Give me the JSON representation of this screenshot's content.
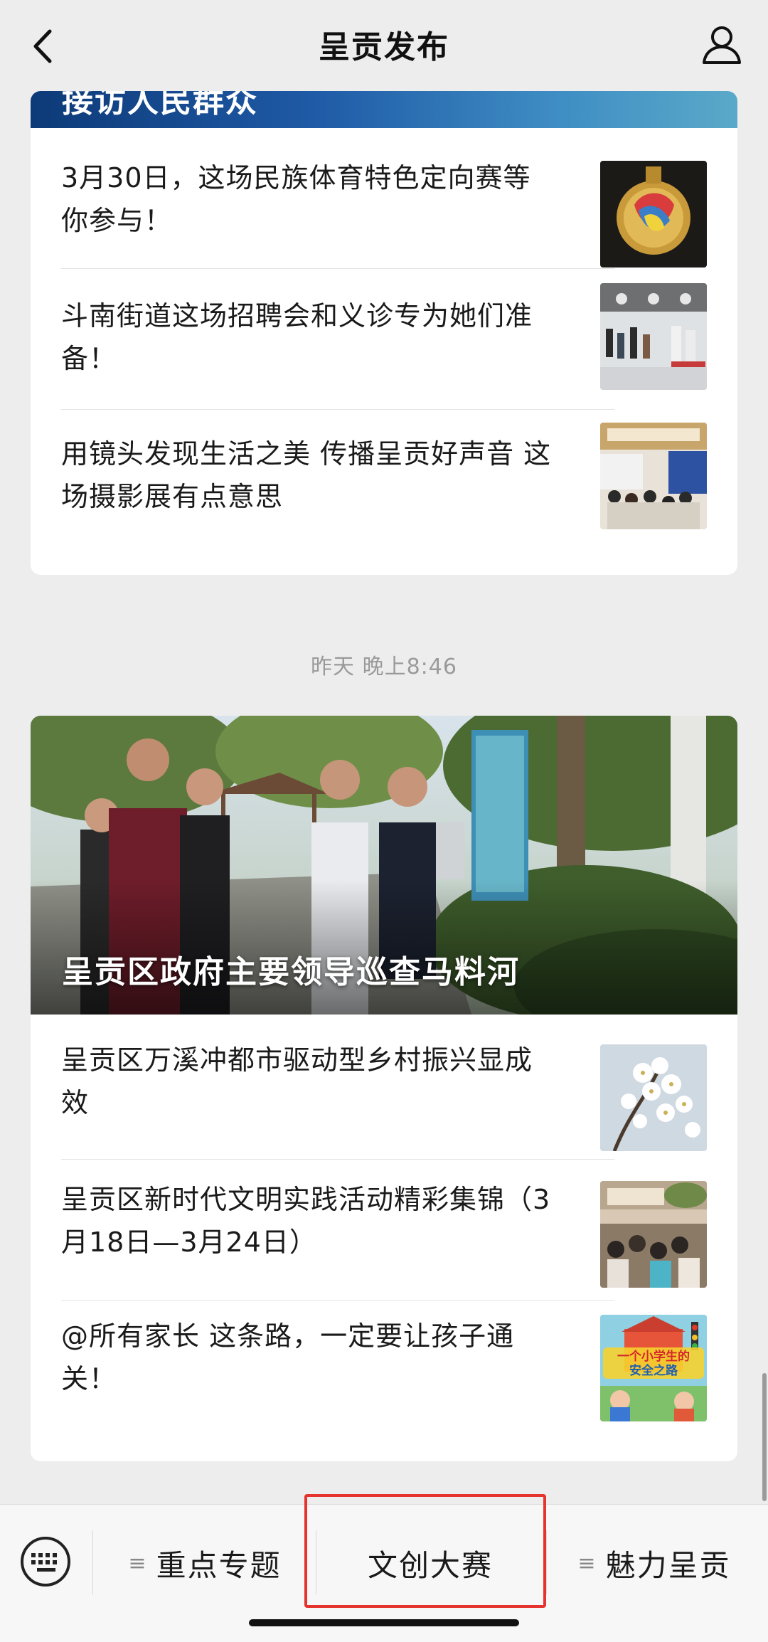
{
  "header": {
    "title": "呈贡发布"
  },
  "card1": {
    "banner_text": "接访人民群众",
    "items": [
      {
        "title_line1": "3月30日，这场民族体育特色定向赛等",
        "title_line2": "你参与！"
      },
      {
        "title_line1": "斗南街道这场招聘会和义诊专为她们准",
        "title_line2": "备！"
      },
      {
        "title_line1": "用镜头发现生活之美 传播呈贡好声音 这",
        "title_line2": "场摄影展有点意思"
      }
    ]
  },
  "timestamp": "昨天 晚上8:46",
  "card2": {
    "hero_title": "呈贡区政府主要领导巡查马料河",
    "items": [
      {
        "title_line1": "呈贡区万溪冲都市驱动型乡村振兴显成",
        "title_line2": "效"
      },
      {
        "title_line1": "呈贡区新时代文明实践活动精彩集锦（3",
        "title_line2": "月18日—3月24日）"
      },
      {
        "title_line1": "@所有家长 这条路，一定要让孩子通",
        "title_line2": "关！",
        "thumb_text_line1": "一个小学生的",
        "thumb_text_line2": "安全之路"
      }
    ]
  },
  "menu": {
    "item1": "重点专题",
    "item2": "文创大赛",
    "item3": "魅力呈贡",
    "menu_lines_glyph": "≡"
  },
  "colors": {
    "highlight": "#e5342e",
    "banner_blue": "#1f5aa6"
  }
}
